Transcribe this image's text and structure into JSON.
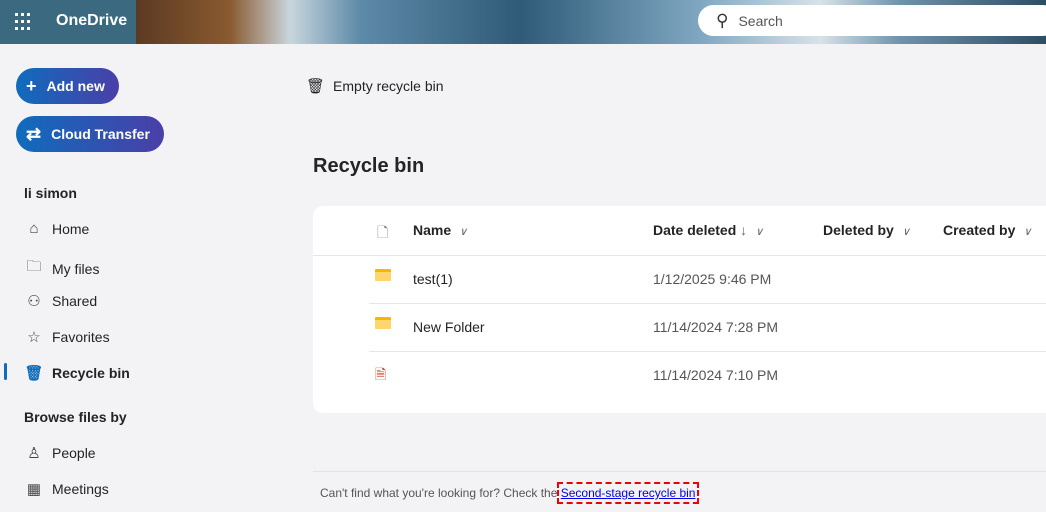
{
  "app": {
    "title": "OneDrive",
    "search_placeholder": "Search"
  },
  "sidebar": {
    "add_new": "Add new",
    "cloud_transfer": "Cloud Transfer",
    "user": "li simon",
    "items": [
      {
        "label": "Home"
      },
      {
        "label": "My files"
      },
      {
        "label": "Shared"
      },
      {
        "label": "Favorites"
      },
      {
        "label": "Recycle bin"
      }
    ],
    "browse_header": "Browse files by",
    "browse_items": [
      {
        "label": "People"
      },
      {
        "label": "Meetings"
      }
    ]
  },
  "toolbar": {
    "empty_label": "Empty recycle bin"
  },
  "main": {
    "title": "Recycle bin",
    "columns": [
      "Name",
      "Date deleted",
      "Deleted by",
      "Created by"
    ],
    "rows": [
      {
        "name": "test(1)",
        "date": "1/12/2025 9:46 PM",
        "type": "folder"
      },
      {
        "name": "New Folder",
        "date": "11/14/2024 7:28 PM",
        "type": "folder"
      },
      {
        "name": "",
        "date": "11/14/2024 7:10 PM",
        "type": "file"
      }
    ]
  },
  "footer": {
    "text": "Can't find what you're looking for? Check the ",
    "link": "Second-stage recycle bin"
  }
}
